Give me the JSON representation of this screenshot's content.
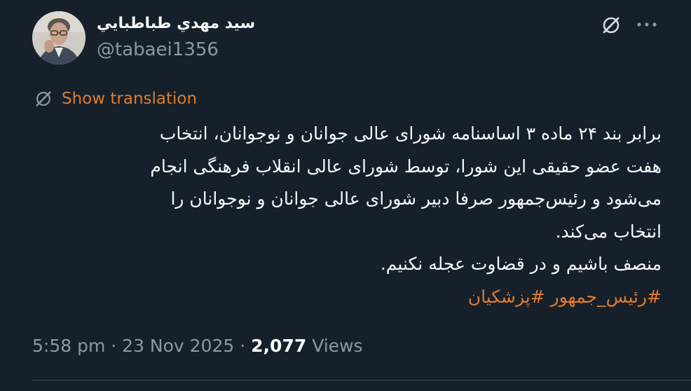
{
  "author": {
    "display_name": "سيد مهدي طباطبايي",
    "handle": "@tabaei1356"
  },
  "translate": {
    "label": "Show translation",
    "icon": "globe-icon"
  },
  "tweet": {
    "lines": [
      "برابر بند ۲۴ ماده ۳ اساسنامه شورای عالی جوانان و نوجوانان، انتخاب",
      "هفت عضو حقیقی این شورا، توسط شورای عالی انقلاب فرهنگی انجام",
      "می‌شود و رئیس‌جمهور صرفا دبیر شورای عالی جوانان و نوجوانان را",
      "انتخاب می‌کند.",
      "منصف باشیم و در قضاوت عجله نکنیم."
    ],
    "hashtags": [
      "#رئیس_جمهور",
      "#پزشکیان"
    ]
  },
  "meta": {
    "time": "5:58 pm",
    "separator": "·",
    "date": "23 Nov 2025",
    "views_count": "2,077",
    "views_label": "Views"
  },
  "colors": {
    "background": "#15202b",
    "text": "#f7f9f9",
    "muted": "#8b98a5",
    "accent": "#e07b2c"
  },
  "icons": {
    "grok": "grok-icon",
    "more": "more-icon"
  }
}
